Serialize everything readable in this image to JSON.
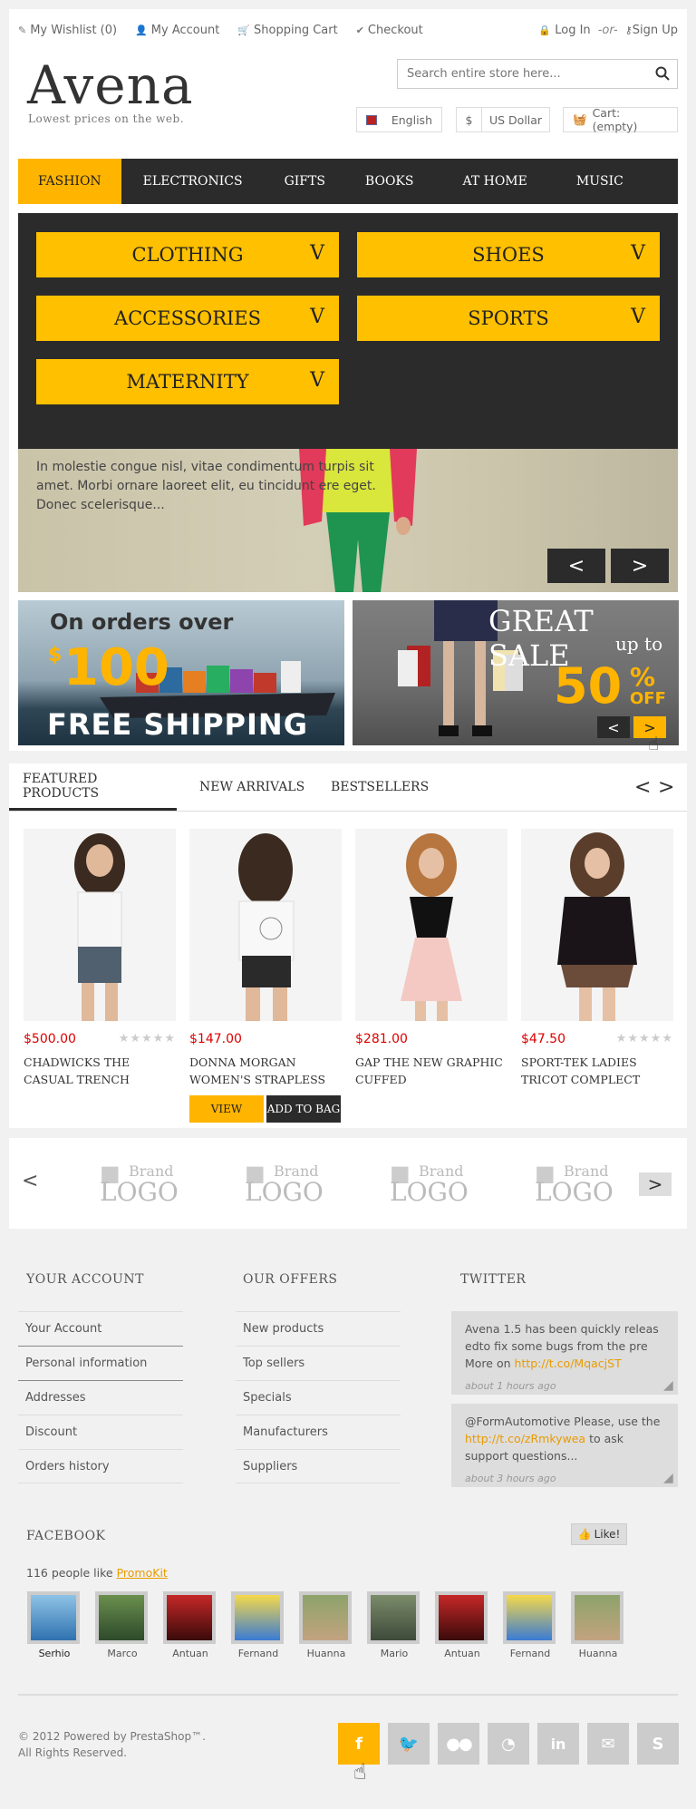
{
  "top_links": {
    "wishlist": "My Wishlist (0)",
    "account": "My Account",
    "cart": "Shopping Cart",
    "checkout": "Checkout",
    "login": "Log In",
    "or": "-or-",
    "signup": "Sign Up"
  },
  "brand": {
    "logo": "Avena",
    "tagline": "Lowest prices on the web."
  },
  "search": {
    "placeholder": "Search entire store here..."
  },
  "header": {
    "language": "English",
    "currency_symbol": "$",
    "currency": "US Dollar",
    "cart": "Cart: (empty)"
  },
  "nav": [
    "FASHION",
    "ELECTRONICS",
    "GIFTS",
    "BOOKS",
    "AT HOME",
    "MUSIC"
  ],
  "mega": [
    "CLOTHING",
    "SHOES",
    "ACCESSORIES",
    "SPORTS",
    "MATERNITY"
  ],
  "mega_chevron": "V",
  "slider": {
    "text": "In molestie congue nisl, vitae condimentum turpis sit amet. Morbi ornare laoreet elit, eu tincidunt ere eget. Donec scelerisque...",
    "prev": "<",
    "next": ">"
  },
  "banner_shipping": {
    "line1": "On orders over",
    "amount": "100",
    "dollar": "$",
    "line2": "FREE SHIPPING"
  },
  "banner_sale": {
    "title": "GREAT SALE",
    "sub": "up to",
    "pct": "50",
    "pct_sign": "%",
    "off": "OFF",
    "prev": "<",
    "next": ">"
  },
  "product_tabs": [
    "FEATURED PRODUCTS",
    "NEW ARRIVALS",
    "BESTSELLERS"
  ],
  "product_arrows": {
    "prev": "<",
    "next": ">"
  },
  "products": [
    {
      "price": "$500.00",
      "name": "CHADWICKS THE CASUAL TRENCH"
    },
    {
      "price": "$147.00",
      "name": "DONNA MORGAN WOMEN'S STRAPLESS"
    },
    {
      "price": "$281.00",
      "name": "GAP THE NEW GRAPHIC CUFFED"
    },
    {
      "price": "$47.50",
      "name": "SPORT-TEK LADIES TRICOT COMPLECT"
    }
  ],
  "product_buttons": {
    "view": "VIEW",
    "bag": "ADD TO BAG"
  },
  "brand_logos": {
    "word1": "Brand",
    "word2": "LOGO",
    "prev": "<",
    "next": ">"
  },
  "footer": {
    "account_title": "YOUR ACCOUNT",
    "account_links": [
      "Your Account",
      "Personal information",
      "Addresses",
      "Discount",
      "Orders history"
    ],
    "offers_title": "OUR OFFERS",
    "offers_links": [
      "New products",
      "Top sellers",
      "Specials",
      "Manufacturers",
      "Suppliers"
    ],
    "twitter_title": "TWITTER",
    "tweets": [
      {
        "pre": "Avena 1.5 has been quickly releas edto fix some bugs from the pre More on ",
        "link": "http://t.co/MqacjST",
        "post": "",
        "time": "about 1 hours ago"
      },
      {
        "pre": "@FormAutomotive Please, use the ",
        "link": "http://t.co/zRmkywea",
        "post": " to ask support questions...",
        "time": "about 3 hours ago"
      }
    ],
    "facebook_title": "FACEBOOK",
    "like_button": "Like!",
    "likes_text": "116 people like ",
    "likes_link": "PromoKit",
    "fans": [
      "Serhio",
      "Marco",
      "Antuan",
      "Fernand",
      "Huanna",
      "Mario",
      "Antuan",
      "Fernand",
      "Huanna"
    ],
    "copyright1": "© 2012 Powered by PrestaShop™.",
    "copyright2": "All Rights Reserved.",
    "social": [
      "facebook-icon",
      "twitter-icon",
      "flickr-icon",
      "rss-icon",
      "linkedin-icon",
      "email-icon",
      "skype-icon"
    ]
  },
  "colors": {
    "accent": "#ffb400",
    "dark": "#2b2b2b",
    "price": "#dd0000"
  }
}
